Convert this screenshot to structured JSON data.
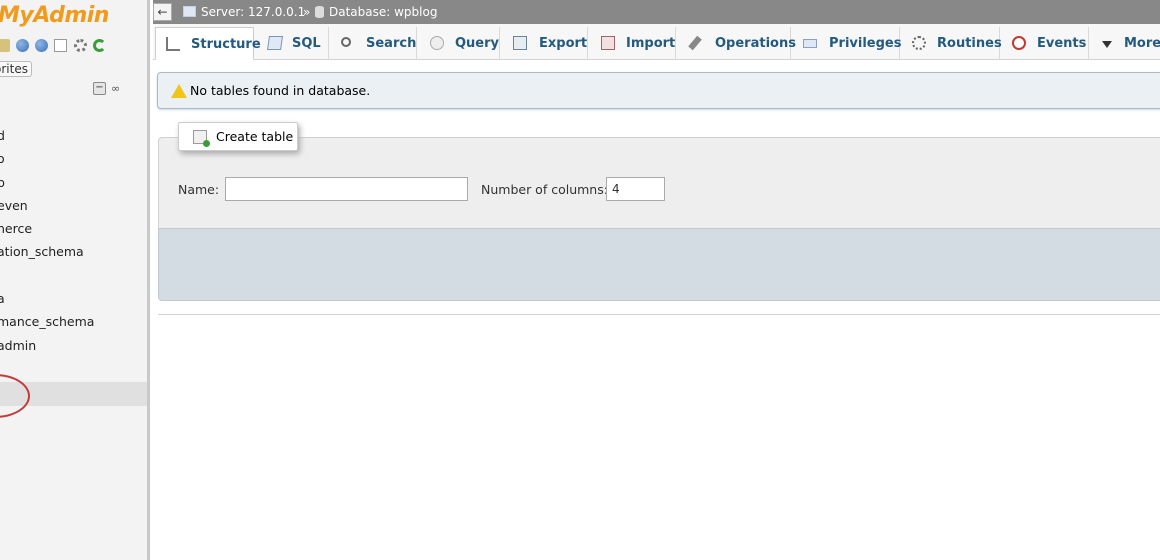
{
  "nav": {
    "logo": "MyAdmin",
    "favorites_label": "orites",
    "databases": [
      "d",
      "o",
      "b",
      "even",
      "nerce",
      "ation_schema",
      "",
      "a",
      "mance_schema",
      "admin",
      ""
    ]
  },
  "header": {
    "back_label": "←",
    "server_label": "Server: 127.0.0.1",
    "separator": "»",
    "database_label": "Database: wpblog"
  },
  "tabs": [
    {
      "label": "Structure",
      "icon": "structure-icon",
      "active": true
    },
    {
      "label": "SQL",
      "icon": "sql-icon"
    },
    {
      "label": "Search",
      "icon": "search-icon"
    },
    {
      "label": "Query",
      "icon": "query-icon"
    },
    {
      "label": "Export",
      "icon": "export-icon"
    },
    {
      "label": "Import",
      "icon": "import-icon"
    },
    {
      "label": "Operations",
      "icon": "operations-icon"
    },
    {
      "label": "Privileges",
      "icon": "privileges-icon"
    },
    {
      "label": "Routines",
      "icon": "routines-icon"
    },
    {
      "label": "Events",
      "icon": "events-icon"
    },
    {
      "label": "More",
      "icon": "chevron-down-icon"
    }
  ],
  "notice": {
    "text": "No tables found in database."
  },
  "create_table": {
    "legend": "Create table",
    "name_label": "Name:",
    "name_value": "",
    "columns_label": "Number of columns:",
    "columns_value": "4"
  },
  "colors": {
    "accent": "#235a81",
    "logo": "#f29a1b",
    "header_bar": "#888888",
    "notice_bg": "#ebf0f4",
    "highlight_ring": "#c23b3b"
  }
}
